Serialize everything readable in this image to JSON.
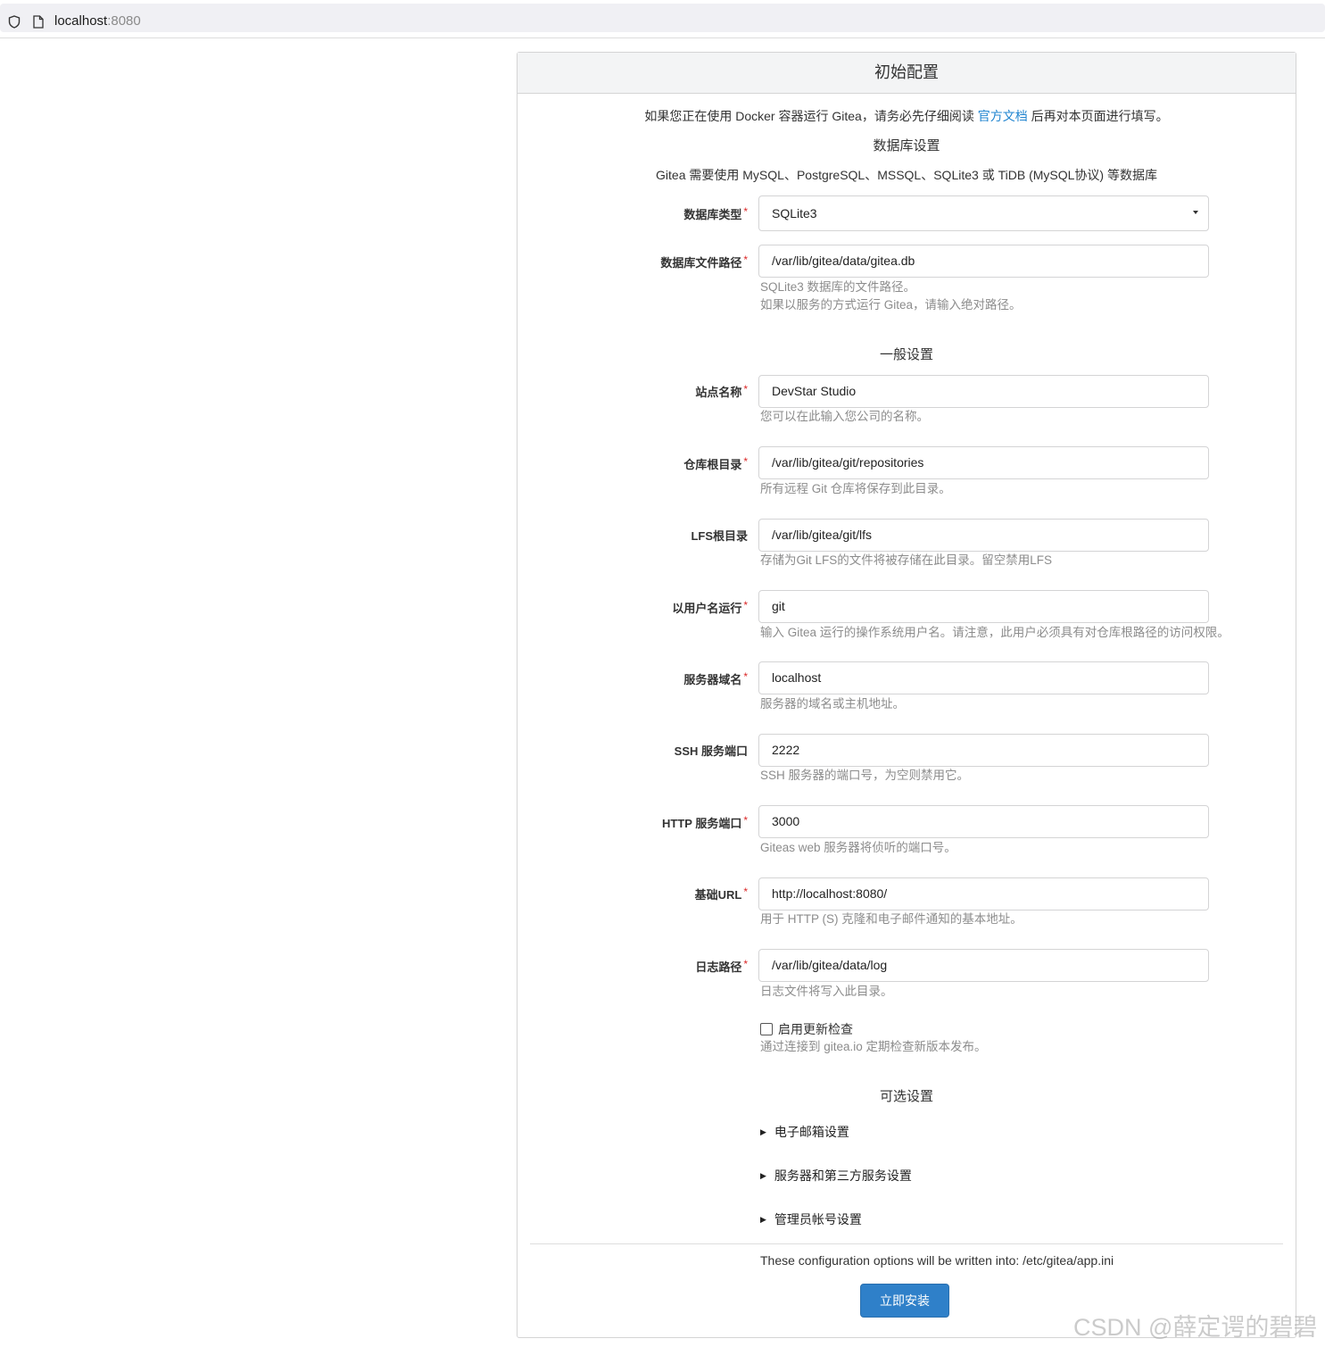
{
  "browser": {
    "url_host": "localhost",
    "url_port": ":8080"
  },
  "panel": {
    "title": "初始配置",
    "intro_before": "如果您正在使用 Docker 容器运行 Gitea，请务必先仔细阅读 ",
    "intro_link": "官方文档",
    "intro_after": " 后再对本页面进行填写。"
  },
  "database": {
    "section_title": "数据库设置",
    "description": "Gitea 需要使用 MySQL、PostgreSQL、MSSQL、SQLite3 或 TiDB (MySQL协议) 等数据库",
    "type_label": "数据库类型",
    "type_value": "SQLite3",
    "path_label": "数据库文件路径",
    "path_value": "/var/lib/gitea/data/gitea.db",
    "path_help_1": "SQLite3 数据库的文件路径。",
    "path_help_2": "如果以服务的方式运行 Gitea，请输入绝对路径。"
  },
  "general": {
    "section_title": "一般设置",
    "site_name_label": "站点名称",
    "site_name_value": "DevStar Studio",
    "site_name_help": "您可以在此输入您公司的名称。",
    "repo_root_label": "仓库根目录",
    "repo_root_value": "/var/lib/gitea/git/repositories",
    "repo_root_help": "所有远程 Git 仓库将保存到此目录。",
    "lfs_root_label": "LFS根目录",
    "lfs_root_value": "/var/lib/gitea/git/lfs",
    "lfs_root_help": "存储为Git LFS的文件将被存储在此目录。留空禁用LFS",
    "run_user_label": "以用户名运行",
    "run_user_value": "git",
    "run_user_help": "输入 Gitea 运行的操作系统用户名。请注意，此用户必须具有对仓库根路径的访问权限。",
    "domain_label": "服务器域名",
    "domain_value": "localhost",
    "domain_help": "服务器的域名或主机地址。",
    "ssh_port_label": "SSH 服务端口",
    "ssh_port_value": "2222",
    "ssh_port_help": "SSH 服务器的端口号，为空则禁用它。",
    "http_port_label": "HTTP 服务端口",
    "http_port_value": "3000",
    "http_port_help": "Giteas web 服务器将侦听的端口号。",
    "base_url_label": "基础URL",
    "base_url_value": "http://localhost:8080/",
    "base_url_help": "用于 HTTP (S) 克隆和电子邮件通知的基本地址。",
    "log_path_label": "日志路径",
    "log_path_value": "/var/lib/gitea/data/log",
    "log_path_help": "日志文件将写入此目录。",
    "update_check_label": "启用更新检查",
    "update_check_checked": false,
    "update_check_help": "通过连接到 gitea.io 定期检查新版本发布。"
  },
  "optional": {
    "section_title": "可选设置",
    "email_settings": "电子邮箱设置",
    "server_settings": "服务器和第三方服务设置",
    "admin_settings": "管理员帐号设置"
  },
  "footer": {
    "config_note": "These configuration options will be written into: /etc/gitea/app.ini",
    "install_button": "立即安装"
  },
  "required_marker": "*",
  "watermark": "CSDN @薛定谔的碧碧",
  "colors": {
    "accent": "#2185d0",
    "button": "#2f80c9",
    "required": "#db2828"
  }
}
